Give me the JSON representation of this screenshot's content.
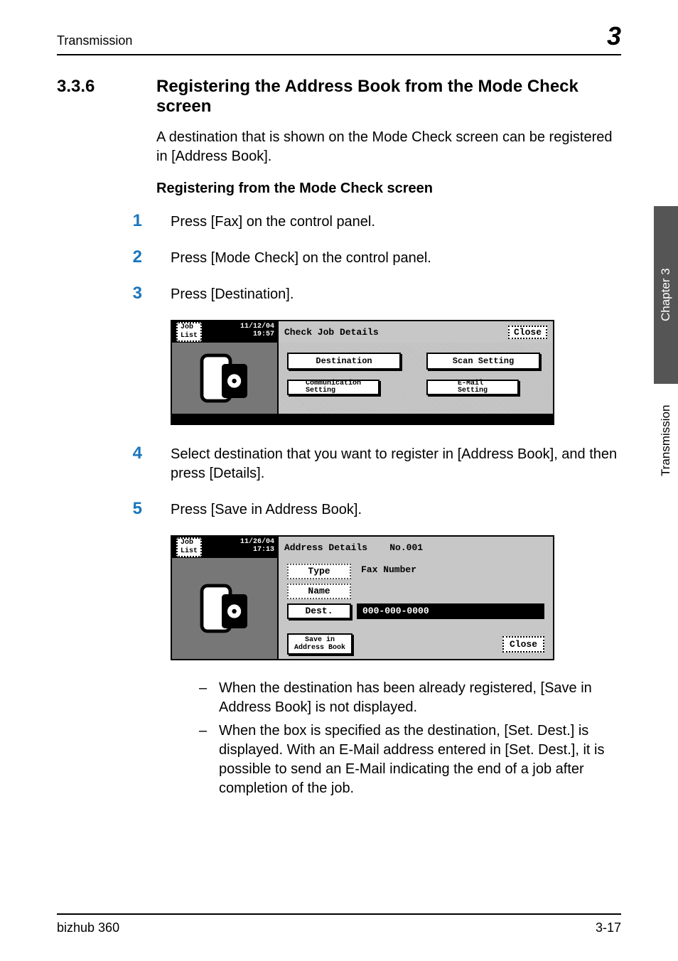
{
  "running_header": {
    "left": "Transmission",
    "chapter_icon": "3"
  },
  "side_tabs": {
    "dark": "Chapter 3",
    "light": "Transmission"
  },
  "heading": {
    "number": "3.3.6",
    "title": "Registering the Address Book from the Mode Check screen"
  },
  "intro": "A destination that is shown on the Mode Check screen can be registered in [Address Book].",
  "subhead": "Registering from the Mode Check screen",
  "steps": {
    "s1": "Press [Fax] on the control panel.",
    "s2": "Press [Mode Check] on the control panel.",
    "s3": "Press [Destination].",
    "s4": "Select destination that you want to register in [Address Book], and then press [Details].",
    "s5": "Press [Save in Address Book]."
  },
  "lcd1": {
    "joblist": "Job\nList",
    "date": "11/12/04",
    "time": "19:57",
    "title": "Check Job Details",
    "close": "Close",
    "buttons": {
      "dest": "Destination",
      "scan": "Scan Setting",
      "comm": "Communication\nSetting",
      "email": "E-Mail\nSetting"
    }
  },
  "lcd2": {
    "joblist": "Job\nList",
    "date": "11/26/04",
    "time": "17:13",
    "title": "Address Details",
    "no": "No.001",
    "rows": {
      "type_lbl": "Type",
      "type_val": "Fax Number",
      "name_lbl": "Name",
      "name_val": "",
      "dest_lbl": "Dest.",
      "dest_val": "000-000-0000"
    },
    "save": "Save in\nAddress Book",
    "close": "Close"
  },
  "notes": {
    "n1": "When the destination has been already registered, [Save in Address Book] is not displayed.",
    "n2": "When the box is specified as the destination, [Set. Dest.] is displayed. With an E-Mail address entered in [Set. Dest.], it is possible to send an E-Mail indicating the end of a job after completion of the job."
  },
  "footer": {
    "left": "bizhub 360",
    "right": "3-17"
  }
}
